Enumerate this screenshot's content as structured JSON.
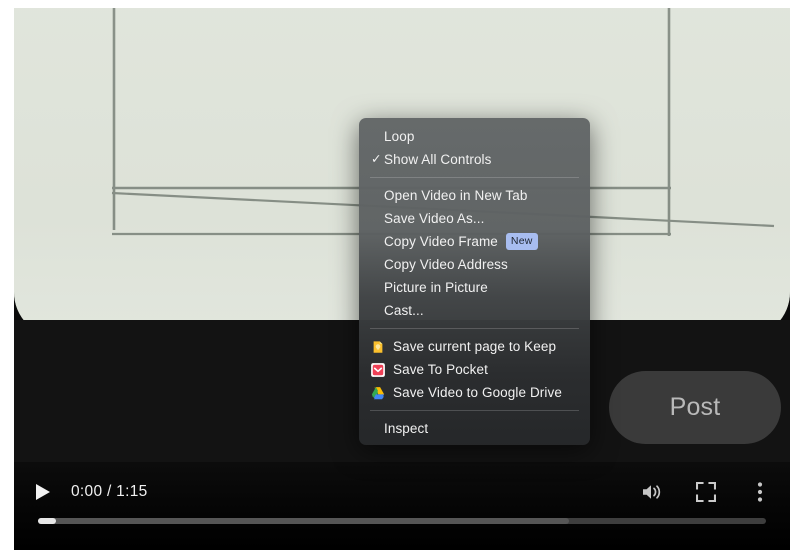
{
  "player": {
    "controls": {
      "play_label": "play-button",
      "time": "0:00 / 1:15",
      "volume_label": "volume",
      "fullscreen_label": "fullscreen",
      "more_label": "more options",
      "progress_played_percent": 2.5,
      "progress_buffered_percent": 73
    },
    "post_button_label": "Post"
  },
  "context_menu": {
    "sections": [
      {
        "items": [
          {
            "label": "Loop",
            "checked": false
          },
          {
            "label": "Show All Controls",
            "checked": true
          }
        ]
      },
      {
        "items": [
          {
            "label": "Open Video in New Tab"
          },
          {
            "label": "Save Video As..."
          },
          {
            "label": "Copy Video Frame",
            "badge": "New"
          },
          {
            "label": "Copy Video Address"
          },
          {
            "label": "Picture in Picture"
          },
          {
            "label": "Cast..."
          }
        ]
      },
      {
        "items": [
          {
            "label": "Save current page to Keep",
            "icon": "google-keep-icon"
          },
          {
            "label": "Save To Pocket",
            "icon": "pocket-icon"
          },
          {
            "label": "Save Video to Google Drive",
            "icon": "google-drive-icon"
          }
        ]
      },
      {
        "items": [
          {
            "label": "Inspect"
          }
        ]
      }
    ]
  },
  "colors": {
    "video_background": "#dfe4da",
    "stage_background": "#131313",
    "menu_top": "#626667",
    "menu_bottom": "#26282a",
    "badge_background": "#a8bdf0",
    "post_button_background": "#3a3a3a"
  }
}
